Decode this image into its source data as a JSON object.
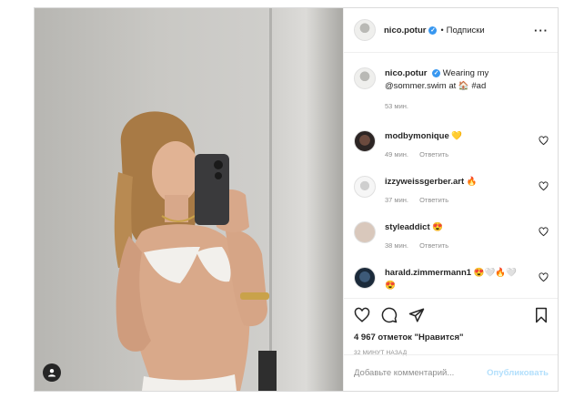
{
  "header": {
    "username": "nico.potur",
    "separator": "•",
    "follow_label": "Подписки",
    "more_icon": "more-horizontal-icon"
  },
  "caption": {
    "username": "nico.potur",
    "text_before": "Wearing my",
    "text_after": "@sommer.swim at",
    "house_emoji": "🏠",
    "hashtag": "#ad",
    "time": "53 мин."
  },
  "comments": [
    {
      "username": "modbymonique",
      "text": "💛",
      "time": "49 мин.",
      "reply": "Ответить"
    },
    {
      "username": "izzyweissgerber.art",
      "text": "🔥",
      "time": "37 мин.",
      "reply": "Ответить"
    },
    {
      "username": "styleaddict",
      "text": "😍",
      "time": "38 мин.",
      "reply": "Ответить"
    },
    {
      "username": "harald.zimmermann1",
      "text": "😍🤍🔥🤍",
      "text2": "😍",
      "time": "",
      "reply": ""
    }
  ],
  "actions": {
    "likes": "4 967 отметок \"Нравится\"",
    "posted_ago": "32 МИНУТ НАЗАД"
  },
  "add_comment": {
    "placeholder": "Добавьте комментарий...",
    "publish_label": "Опубликовать"
  },
  "colors": {
    "verified": "#3897f0",
    "publish_disabled": "#b2dffc",
    "muted": "#8e8e8e"
  }
}
